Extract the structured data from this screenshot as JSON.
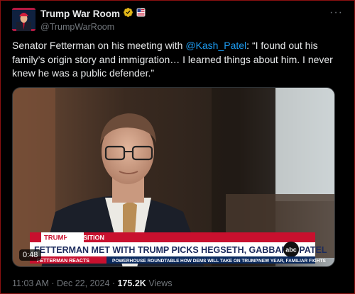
{
  "account": {
    "display_name": "Trump War Room",
    "handle": "@TrumpWarRoom",
    "verified_badge": "gold-verified-icon",
    "affiliate_badge": "flag-badge-icon"
  },
  "tweet": {
    "text_before": "Senator Fetterman on his meeting with ",
    "mention": "@Kash_Patel",
    "text_after": ": “I found out his family’s origin story and immigration… I learned things about him. I never knew he was a public defender.”"
  },
  "video": {
    "duration": "0:48",
    "lower_third": {
      "tag_brand": "TRUMP",
      "tag_label": "TRANSITION",
      "headline": "FETTERMAN MET WITH TRUMP PICKS HEGSETH, GABBARD, PATEL",
      "network": "abc",
      "ticker_primary": "FETTERMAN REACTS",
      "ticker_items": [
        "POWERHOUSE ROUNDTABLE",
        "HOW DEMS WILL TAKE ON TRUMP",
        "NEW YEAR, FAMILIAR FIGHTS"
      ]
    }
  },
  "meta": {
    "time": "11:03 AM",
    "separator": "·",
    "date": "Dec 22, 2024",
    "views_count": "175.2K",
    "views_label": "Views"
  },
  "colors": {
    "mention": "#1d9bf0",
    "secondary_text": "#71767b",
    "verified": "#e2b719",
    "frame_border": "#8a1010"
  }
}
